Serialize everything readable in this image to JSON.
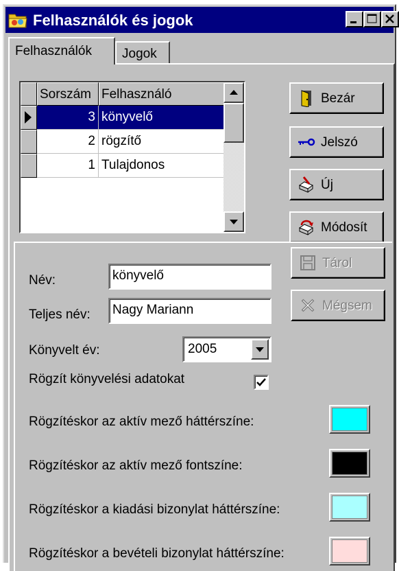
{
  "window": {
    "title": "Felhasználók és jogok"
  },
  "tabs": [
    {
      "label": "Felhasználók",
      "active": true
    },
    {
      "label": "Jogok",
      "active": false
    }
  ],
  "grid": {
    "columns": [
      "Sorszám",
      "Felhasználó"
    ],
    "rows": [
      {
        "num": "3",
        "name": "könyvelő",
        "selected": true
      },
      {
        "num": "2",
        "name": "rögzítő",
        "selected": false
      },
      {
        "num": "1",
        "name": "Tulajdonos",
        "selected": false
      }
    ]
  },
  "buttons": {
    "close": "Bezár",
    "password": "Jelszó",
    "new": "Új",
    "modify": "Módosít",
    "save": "Tárol",
    "cancel": "Mégsem"
  },
  "form": {
    "name_label": "Név:",
    "name_value": "könyvelő",
    "fullname_label": "Teljes név:",
    "fullname_value": "Nagy Mariann",
    "year_label": "Könyvelt év:",
    "year_value": "2005",
    "record_label": "Rögzít könyvelési adatokat",
    "record_checked": true
  },
  "colors": [
    {
      "label": "Rögzítéskor az aktív mező háttérszíne:",
      "color": "#00ffff"
    },
    {
      "label": "Rögzítéskor az aktív mező fontszíne:",
      "color": "#000000"
    },
    {
      "label": "Rögzítéskor a kiadási bizonylat háttérszíne:",
      "color": "#aaffff"
    },
    {
      "label": "Rögzítéskor a bevételi bizonylat háttérszíne:",
      "color": "#ffdcdc"
    }
  ],
  "icons": {
    "app": "app-folder-icon",
    "close": "door-icon",
    "password": "key-icon",
    "new": "new-document-icon",
    "modify": "edit-document-icon",
    "save": "floppy-disk-icon",
    "cancel": "cancel-x-icon"
  }
}
